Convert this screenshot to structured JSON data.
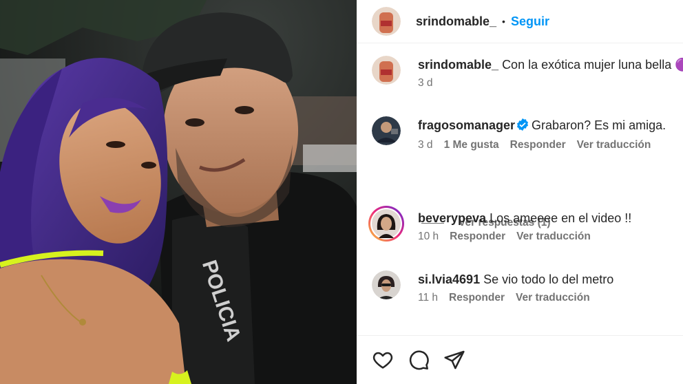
{
  "post": {
    "author": "srindomable_",
    "follow_label": "Seguir",
    "separator": "•"
  },
  "photo": {
    "vest_text": "POLICIA"
  },
  "comments": [
    {
      "username": "srindomable_",
      "text": "Con la exótica mujer luna bella 🟣",
      "time": "3 d"
    },
    {
      "username": "fragosomanager",
      "verified": true,
      "text": "Grabaron? Es mi amiga.",
      "time": "3 d",
      "likes": "1 Me gusta",
      "reply_label": "Responder",
      "translate_label": "Ver traducción"
    },
    {
      "username": "beverypeva",
      "text": "Los ameeee en el video !!",
      "time": "10 h",
      "reply_label": "Responder",
      "translate_label": "Ver traducción"
    },
    {
      "username": "si.lvia4691",
      "text": "Se vio todo lo del metro",
      "time": "11 h",
      "reply_label": "Responder",
      "translate_label": "Ver traducción"
    }
  ],
  "view_replies": "Ver respuestas (1)",
  "icons": {
    "like": "heart-icon",
    "comment": "comment-icon",
    "share": "share-icon",
    "verified": "verified-badge-icon"
  },
  "colors": {
    "follow": "#0095f6",
    "verified": "#0095f6",
    "story_ring_start": "#f9ce34",
    "story_ring_end": "#ee2a7b"
  }
}
